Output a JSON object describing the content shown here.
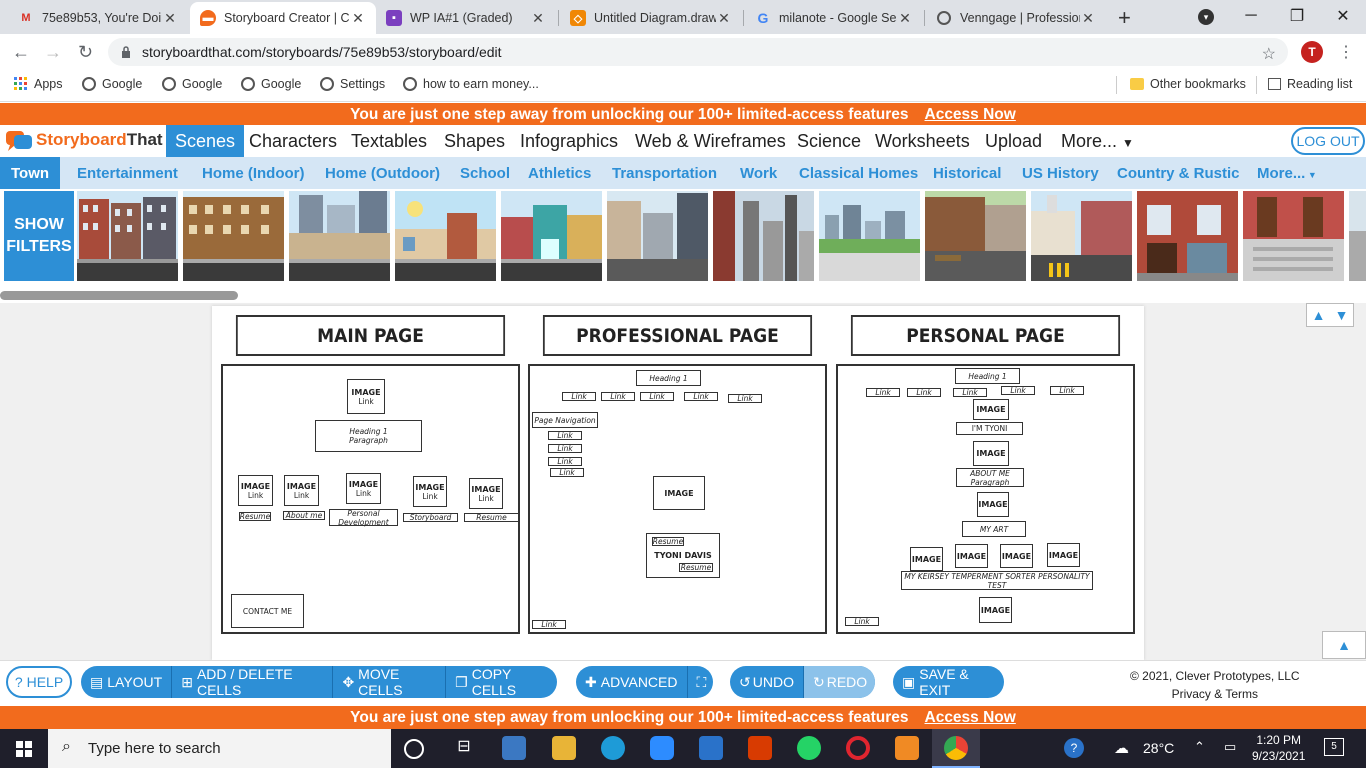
{
  "browser": {
    "tabs": [
      {
        "title": "75e89b53, You're Doin",
        "icon": "gmail-icon",
        "active": false
      },
      {
        "title": "Storyboard Creator | C",
        "icon": "storyboardthat-icon",
        "active": true
      },
      {
        "title": "WP IA#1 (Graded)",
        "icon": "classroom-icon",
        "active": false
      },
      {
        "title": "Untitled Diagram.draw",
        "icon": "drawio-icon",
        "active": false
      },
      {
        "title": "milanote - Google Sea",
        "icon": "google-icon",
        "active": false
      },
      {
        "title": "Venngage | Profession",
        "icon": "globe-icon",
        "active": false
      }
    ],
    "url": "storyboardthat.com/storyboards/75e89b53/storyboard/edit",
    "profile_initial": "T",
    "bookmarks": [
      "Apps",
      "Google",
      "Google",
      "Google",
      "Settings",
      "how to earn money..."
    ],
    "other_bookmarks": "Other bookmarks",
    "reading_list": "Reading list"
  },
  "promo": {
    "text": "You are just one step away from unlocking our 100+ limited-access features",
    "link": "Access Now"
  },
  "sbt": {
    "logo_part1": "Storyboard",
    "logo_part2": "That",
    "menu": [
      "Scenes",
      "Characters",
      "Textables",
      "Shapes",
      "Infographics",
      "Web & Wireframes",
      "Science",
      "Worksheets",
      "Upload",
      "More..."
    ],
    "logout": "LOG OUT",
    "categories": [
      "Town",
      "Entertainment",
      "Home (Indoor)",
      "Home (Outdoor)",
      "School",
      "Athletics",
      "Transportation",
      "Work",
      "Classical Homes",
      "Historical",
      "US History",
      "Country & Rustic",
      "More..."
    ],
    "show_filters": [
      "SHOW",
      "FILTERS"
    ]
  },
  "storyboard": {
    "headers": [
      "MAIN PAGE",
      "PROFESSIONAL PAGE",
      "PERSONAL PAGE"
    ],
    "main": {
      "top_image": "IMAGE",
      "top_link": "Link",
      "heading": "Heading 1",
      "paragraph": "Paragraph",
      "images": [
        {
          "img": "IMAGE",
          "link": "Link",
          "caption": "Resume"
        },
        {
          "img": "IMAGE",
          "link": "Link",
          "caption": "About me"
        },
        {
          "img": "IMAGE",
          "link": "Link",
          "caption": "Personal Development"
        },
        {
          "img": "IMAGE",
          "link": "Link",
          "caption": "Storyboard"
        },
        {
          "img": "IMAGE",
          "link": "Link",
          "caption": "Resume"
        }
      ],
      "contact": "CONTACT ME"
    },
    "professional": {
      "heading": "Heading 1",
      "links": [
        "Link",
        "Link",
        "Link",
        "Link",
        "Link"
      ],
      "page_nav": "Page Navigation",
      "nav_links": [
        "Link",
        "Link",
        "Link",
        "Link"
      ],
      "image": "IMAGE",
      "resume_top": "Resume",
      "name": "TYONI DAVIS",
      "resume_bottom": "Resume",
      "footer_link": "Link"
    },
    "personal": {
      "heading": "Heading 1",
      "links": [
        "Link",
        "Link",
        "Link",
        "Link",
        "Link"
      ],
      "image": "IMAGE",
      "im_tyoni": "I'M TYONI",
      "about_me": "ABOUT ME",
      "paragraph": "Paragraph",
      "my_art": "MY ART",
      "keirsey": "MY KEIRSEY TEMPERMENT SORTER PERSONALITY TEST",
      "footer_link": "Link"
    }
  },
  "toolbar": {
    "help": "HELP",
    "layout": "LAYOUT",
    "add_delete": "ADD / DELETE CELLS",
    "move": "MOVE CELLS",
    "copy": "COPY CELLS",
    "advanced": "ADVANCED",
    "undo": "UNDO",
    "redo": "REDO",
    "save": "SAVE & EXIT",
    "copyright": "© 2021, Clever Prototypes, LLC",
    "privacy": "Privacy & Terms"
  },
  "taskbar": {
    "search_placeholder": "Type here to search",
    "weather": "28°C",
    "time": "1:20 PM",
    "date": "9/23/2021",
    "notifications": "5"
  },
  "colors": {
    "brand_orange": "#f26b1d",
    "brand_blue": "#2d8fd6"
  }
}
